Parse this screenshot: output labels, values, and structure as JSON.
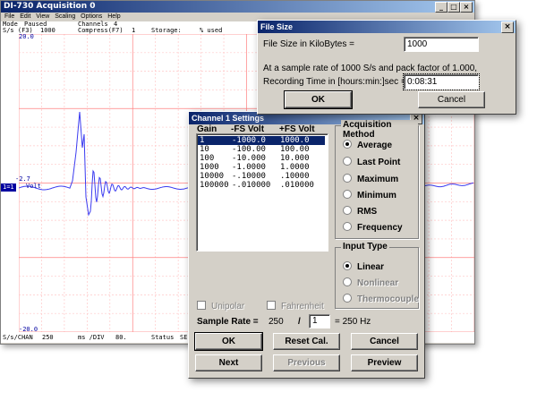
{
  "main_window": {
    "title": "DI-730 Acquisition 0",
    "menu": [
      "File",
      "Edit",
      "View",
      "Scaling",
      "Options",
      "Help"
    ],
    "status_row1": [
      "Mode",
      "Paused",
      "Channels",
      "4"
    ],
    "status_row2": [
      "S/s (F3)",
      "1000",
      "Compress(F7)",
      "1",
      "Storage:",
      "% used"
    ],
    "axis_top": "20.0",
    "axis_bottom": "-20.0",
    "axis_mid_value": "-2.7",
    "axis_mid_unit": "Volt",
    "channel_tag": "1=1",
    "bottom": [
      "S/s/CHAN",
      "250",
      "ms /DIV",
      "80.",
      "Status",
      "SE"
    ]
  },
  "file_size_dialog": {
    "title": "File Size",
    "size_label": "File Size in KiloBytes =",
    "size_value": "1000",
    "rate_text": "At a sample rate of 1000 S/s and pack factor of 1.000,",
    "time_label": "Recording Time in [hours:min:]sec =",
    "time_value": "0:08:31",
    "ok_label": "OK",
    "cancel_label": "Cancel"
  },
  "channel_dialog": {
    "title": "Channel 1 Settings",
    "headers": [
      "Gain",
      "-FS Volt",
      "+FS Volt"
    ],
    "rows": [
      [
        "1",
        "-1000.0",
        "1000.0"
      ],
      [
        "10",
        "-100.00",
        "100.00"
      ],
      [
        "100",
        "-10.000",
        "10.000"
      ],
      [
        "1000",
        "-1.0000",
        "1.0000"
      ],
      [
        "10000",
        "-.10000",
        ".10000"
      ],
      [
        "100000",
        "-.010000",
        ".010000"
      ]
    ],
    "acq_title": "Acquisition Method",
    "acq_options": [
      "Average",
      "Last Point",
      "Maximum",
      "Minimum",
      "RMS",
      "Frequency"
    ],
    "input_title": "Input Type",
    "input_options": [
      "Linear",
      "Nonlinear",
      "Thermocouple"
    ],
    "unipolar": "Unipolar",
    "fahrenheit": "Fahrenheit",
    "rate_label": "Sample Rate =",
    "rate_value": "250",
    "slash": "/",
    "divisor": "1",
    "rate_result": "= 250 Hz",
    "buttons": {
      "ok": "OK",
      "reset": "Reset Cal.",
      "cancel": "Cancel",
      "next": "Next",
      "previous": "Previous",
      "preview": "Preview"
    }
  },
  "colors": {
    "waveform": "#3b3bf0",
    "grid_major": "#ff8080",
    "grid_minor": "#ffc8c8",
    "title_blue": "#0a246a"
  }
}
